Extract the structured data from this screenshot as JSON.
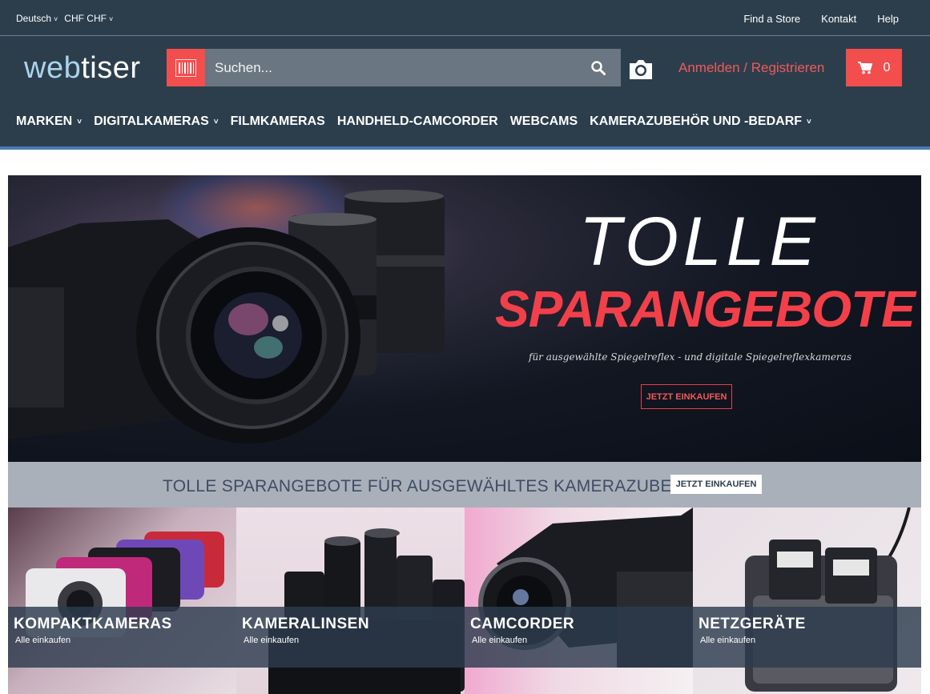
{
  "topbar": {
    "language": "Deutsch",
    "currency": "CHF CHF",
    "links": [
      "Find a Store",
      "Kontakt",
      "Help"
    ]
  },
  "logo": {
    "part1": "web",
    "part2": "tiser"
  },
  "search": {
    "placeholder": "Suchen..."
  },
  "account": {
    "login": "Anmelden / Registrieren"
  },
  "cart": {
    "count": "0"
  },
  "nav": [
    "MARKEN",
    "DIGITALKAMERAS",
    "FILMKAMERAS",
    "HANDHELD-CAMCORDER",
    "WEBCAMS",
    "KAMERAZUBEHÖR UND -BEDARF"
  ],
  "hero": {
    "title1": "TOLLE",
    "title2": "SPARANGEBOTE",
    "subtitle": "für ausgewählte Spiegelreflex - und digitale Spiegelreflexkameras",
    "cta": "JETZT EINKAUFEN"
  },
  "promo": {
    "text": "TOLLE SPARANGEBOTE FÜR AUSGEWÄHLTES KAMERAZUBEHÖR",
    "cta": "JETZT EINKAUFEN"
  },
  "categories": [
    {
      "name": "KOMPAKTKAMERAS",
      "link": "Alle einkaufen"
    },
    {
      "name": "KAMERALINSEN",
      "link": "Alle einkaufen"
    },
    {
      "name": "CAMCORDER",
      "link": "Alle einkaufen"
    },
    {
      "name": "NETZGERÄTE",
      "link": "Alle einkaufen"
    }
  ],
  "colors": {
    "header": "#2c3e4c",
    "accent": "#f24e4e",
    "logo_light": "#a9d4ec",
    "nav_line": "#4a79b8"
  },
  "icons": [
    "chevron-down-icon",
    "barcode-icon",
    "search-icon",
    "camera-icon",
    "cart-icon"
  ]
}
